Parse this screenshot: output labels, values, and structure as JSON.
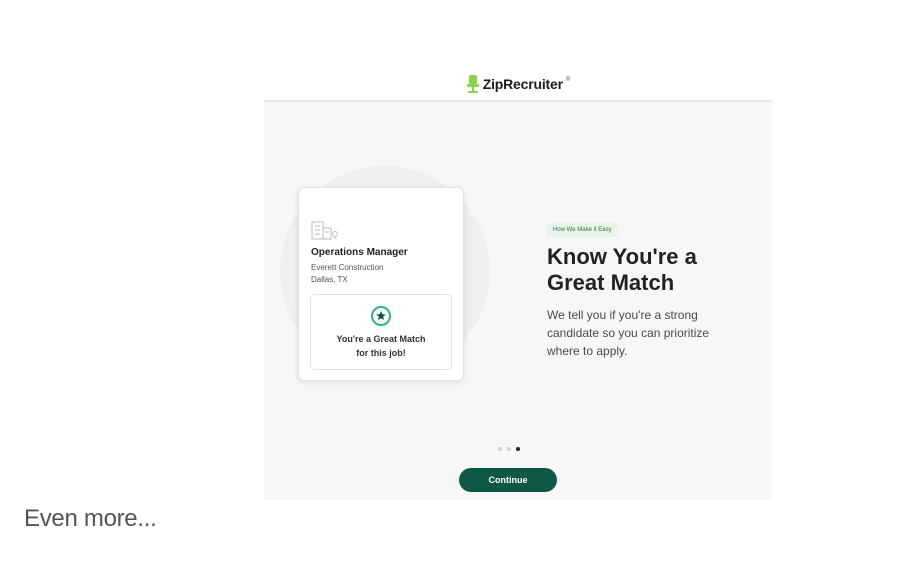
{
  "brand": {
    "name": "ZipRecruiter",
    "mark": "®",
    "accent_color": "#8bd14a"
  },
  "card": {
    "job_title": "Operations Manager",
    "company": "Everett Construction",
    "location": "Dallas, TX",
    "match_text": "You're a Great Match\nfor this job!",
    "icon": "building-icon",
    "badge_icon": "star-badge-icon"
  },
  "promo": {
    "tag": "How We Make it Easy",
    "headline": "Know You're a\nGreat Match",
    "description": "We tell you if you're a strong\ncandidate so you can prioritize\nwhere to apply."
  },
  "carousel": {
    "total_pages": 3,
    "current_page": 3
  },
  "actions": {
    "continue_label": "Continue",
    "continue_color": "#0d5946"
  },
  "caption": "Even more..."
}
